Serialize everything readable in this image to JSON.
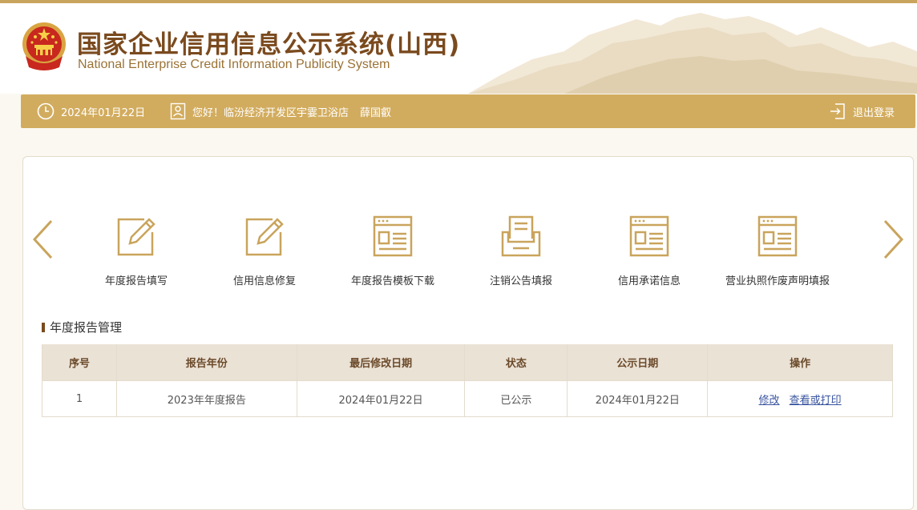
{
  "header": {
    "title_cn": "国家企业信用信息公示系统(山西)",
    "title_en": "National Enterprise Credit Information Publicity System"
  },
  "infobar": {
    "date": "2024年01月22日",
    "greeting": "您好！临汾经济开发区宇霎卫浴店",
    "user_name": "薛国叡",
    "logout": "退出登录"
  },
  "nav": {
    "items": [
      {
        "label": "年度报告填写",
        "icon": "edit-form-icon"
      },
      {
        "label": "信用信息修复",
        "icon": "edit-form-icon"
      },
      {
        "label": "年度报告模板下载",
        "icon": "document-template-icon"
      },
      {
        "label": "注销公告填报",
        "icon": "inbox-tray-icon"
      },
      {
        "label": "信用承诺信息",
        "icon": "document-template-icon"
      },
      {
        "label": "营业执照作废声明填报",
        "icon": "document-template-icon"
      }
    ]
  },
  "section": {
    "title": "年度报告管理"
  },
  "table": {
    "headers": [
      "序号",
      "报告年份",
      "最后修改日期",
      "状态",
      "公示日期",
      "操作"
    ],
    "rows": [
      {
        "index": "1",
        "year": "2023年年度报告",
        "modified": "2024年01月22日",
        "status": "已公示",
        "publish_date": "2024年01月22日",
        "action_edit": "修改",
        "action_view": "查看或打印"
      }
    ]
  },
  "colors": {
    "accent": "#d2ac5e",
    "title_brown": "#7a4a1e",
    "icon_gold": "#c9a45c"
  }
}
